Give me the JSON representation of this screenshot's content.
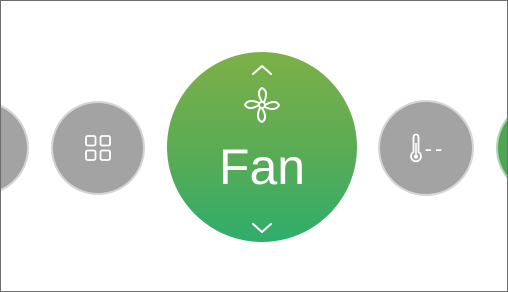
{
  "mode": {
    "label": "Fan",
    "icon": "fan-icon",
    "accent_top": "#7db047",
    "accent_bottom": "#2fad6c"
  },
  "temperature": {
    "value": "--",
    "icon": "thermometer-icon"
  },
  "menu": {
    "icon": "grid-icon"
  },
  "colors": {
    "inactive_circle": "#a3a3a3",
    "next_mode_circle": "#4fa456"
  }
}
